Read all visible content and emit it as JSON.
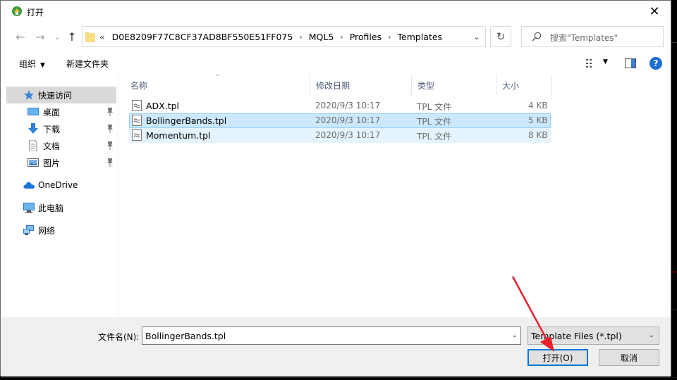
{
  "window": {
    "title": "打开",
    "close_glyph": "✕"
  },
  "nav": {
    "back": "←",
    "forward": "→",
    "recent": "⌄",
    "up": "↑"
  },
  "address": {
    "overflow": "«",
    "crumbs": [
      "D0E8209F77C8CF37AD8BF550E51FF075",
      "MQL5",
      "Profiles",
      "Templates"
    ],
    "separator": "›",
    "dropdown": "⌄",
    "refresh": "↻"
  },
  "search": {
    "placeholder": "搜索\"Templates\""
  },
  "toolbar": {
    "organize": "组织",
    "organize_arrow": "▼",
    "new_folder": "新建文件夹",
    "view_arrow": "▼",
    "help": "?"
  },
  "sidebar": {
    "items": [
      {
        "label": "快速访问",
        "icon": "star-icon"
      },
      {
        "label": "桌面",
        "icon": "desktop-icon"
      },
      {
        "label": "下载",
        "icon": "download-icon"
      },
      {
        "label": "文档",
        "icon": "document-icon"
      },
      {
        "label": "图片",
        "icon": "picture-icon"
      },
      {
        "label": "OneDrive",
        "icon": "cloud-icon"
      },
      {
        "label": "此电脑",
        "icon": "computer-icon"
      },
      {
        "label": "网络",
        "icon": "network-icon"
      }
    ]
  },
  "columns": {
    "name": "名称",
    "date": "修改日期",
    "type": "类型",
    "size": "大小",
    "sort_indicator": "^"
  },
  "files": [
    {
      "name": "ADX.tpl",
      "date": "2020/9/3 10:17",
      "type": "TPL 文件",
      "size": "4 KB"
    },
    {
      "name": "BollingerBands.tpl",
      "date": "2020/9/3 10:17",
      "type": "TPL 文件",
      "size": "5 KB"
    },
    {
      "name": "Momentum.tpl",
      "date": "2020/9/3 10:17",
      "type": "TPL 文件",
      "size": "8 KB"
    }
  ],
  "bottom": {
    "filename_label": "文件名(N):",
    "filename_value": "BollingerBands.tpl",
    "dropdown": "⌄",
    "filetype_value": "Template Files (*.tpl)",
    "open_button": "打开(O)",
    "cancel_button": "取消"
  },
  "colors": {
    "selection": "#cce8ff",
    "hover": "#e5f3ff",
    "accent": "#0078d7",
    "annotation": "#e8202a"
  }
}
